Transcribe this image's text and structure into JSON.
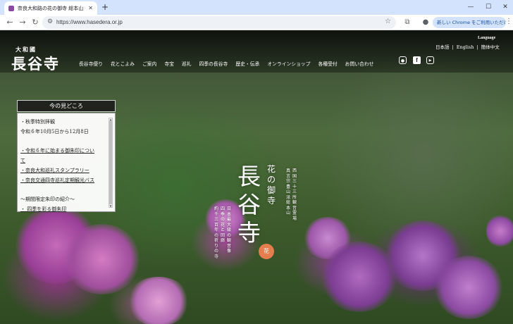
{
  "browser": {
    "tab_title": "奈良大和路の花の御寺 総本山 長谷寺",
    "tab_close": "✕",
    "new_tab": "+",
    "url": "https://www.hasedera.or.jp",
    "profile_button": "新しい Chrome をご利用いただけます",
    "window_minimize": "—",
    "window_maximize": "☐",
    "window_close": "✕"
  },
  "site": {
    "logo_sub": "大和國",
    "logo_main": "長谷寺",
    "nav": [
      "長谷寺便り",
      "花とこよみ",
      "ご案内",
      "寺宝",
      "巡礼",
      "四季の長谷寺",
      "歴史・伝承",
      "オンラインショップ",
      "各種受付",
      "お問い合わせ"
    ],
    "language_title": "Language",
    "languages": [
      "日本語",
      "|",
      "English",
      "|",
      "簡体中文"
    ],
    "social_icons": [
      "instagram-icon",
      "facebook-icon",
      "youtube-icon"
    ]
  },
  "notice": {
    "title": "今の見どころ",
    "lines": [
      {
        "text": "・秋季特別拝観",
        "link": false
      },
      {
        "text": "令和６年10月5日から12月8日",
        "link": false
      },
      {
        "text": "",
        "link": false
      },
      {
        "text": "・令和６年に始まる御朱印につい",
        "link": true
      },
      {
        "text": "て",
        "link": true
      },
      {
        "text": "・奈良大和巡礼スタンプラリー",
        "link": true
      },
      {
        "text": "・奈良交通四寺巡礼定期観光バス",
        "link": true
      },
      {
        "text": "",
        "link": false
      },
      {
        "text": "～期間限定朱印の紹介～",
        "link": false
      },
      {
        "text": "・ 四季を彩る御朱印",
        "link": true
      }
    ]
  },
  "hero": {
    "main": "長谷寺",
    "sub": "花の御寺",
    "col1": "西国三十三所観音霊場",
    "col2": "真言宗豊山派総本山",
    "col3": "日本最大級の観音像",
    "col4": "四季の花と回廊",
    "col5": "約千三百年の祈りの寺",
    "seal": "花"
  }
}
